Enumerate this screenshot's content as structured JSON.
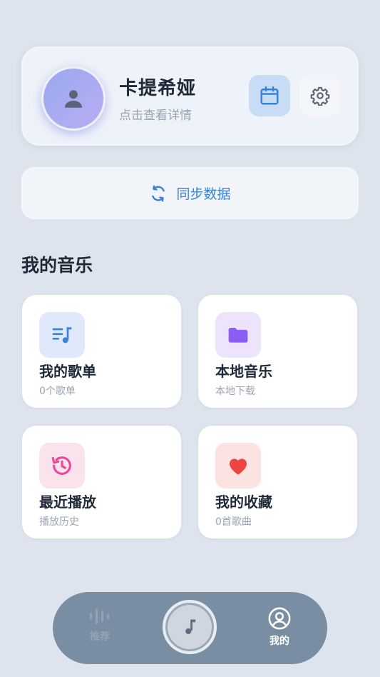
{
  "profile": {
    "name": "卡提希娅",
    "subtitle": "点击查看详情"
  },
  "sync": {
    "label": "同步数据"
  },
  "section": {
    "title": "我的音乐"
  },
  "cards": [
    {
      "title": "我的歌单",
      "sub": "0个歌单",
      "icon": "playlist-icon",
      "icon_bg": "#dfe9fb",
      "icon_color": "#3b82d6"
    },
    {
      "title": "本地音乐",
      "sub": "本地下载",
      "icon": "folder-icon",
      "icon_bg": "#ede4fb",
      "icon_color": "#8b5cf6"
    },
    {
      "title": "最近播放",
      "sub": "播放历史",
      "icon": "history-icon",
      "icon_bg": "#fbe3ee",
      "icon_color": "#ec4899"
    },
    {
      "title": "我的收藏",
      "sub": "0首歌曲",
      "icon": "heart-icon",
      "icon_bg": "#fde2e2",
      "icon_color": "#ef4444"
    }
  ],
  "nav": {
    "recommend": "推荐",
    "mine": "我的"
  },
  "colors": {
    "background": "#dde4ee",
    "accent": "#3b82d6",
    "nav_bg": "#7a8ea3"
  }
}
